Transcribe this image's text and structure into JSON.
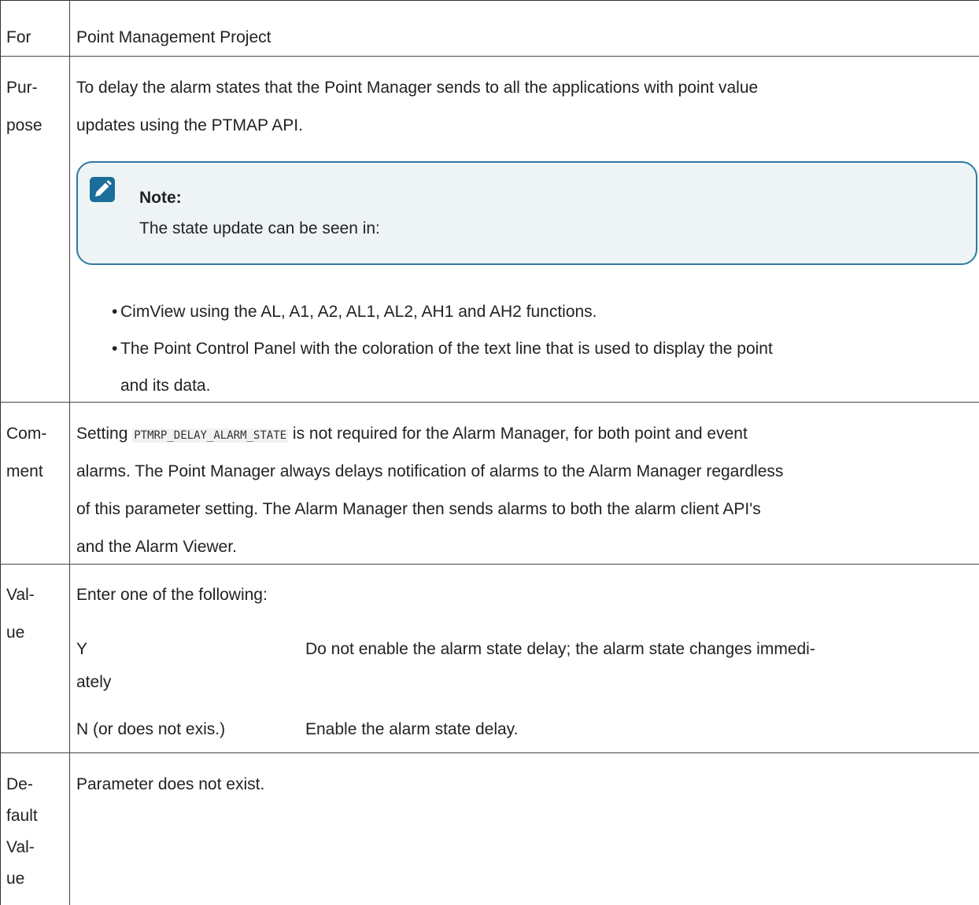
{
  "rows": {
    "for": {
      "label": "For",
      "text": "Point Management Project"
    },
    "purpose": {
      "label": [
        "Pur-",
        "pose"
      ],
      "text_lines": [
        "To delay the alarm states that the Point Manager sends to all the applications with point value",
        "updates using the PTMAP API."
      ],
      "note": {
        "icon": "pencil-note-icon",
        "title": "Note:",
        "body": "The state update can be seen in:"
      },
      "bullets": [
        "CimView using the AL, A1, A2, AL1, AL2, AH1 and  AH2 functions.",
        "The Point Control Panel with the coloration of the text line that is used to display the point"
      ],
      "bullet2_cont": "and its data."
    },
    "comment": {
      "label": [
        "Com-",
        "ment"
      ],
      "line1_pre": "Setting ",
      "code": "PTMRP_DELAY_ALARM_STATE",
      "line1_post": " is not required for the Alarm Manager, for both point and event",
      "lines": [
        "alarms. The Point Manager always delays notification of alarms to the Alarm Manager regardless",
        "of this parameter setting. The Alarm Manager then sends alarms to both the alarm client API's",
        "and the Alarm Viewer."
      ]
    },
    "value": {
      "label": [
        "Val-",
        "ue"
      ],
      "intro": "Enter one of the following:",
      "options": [
        {
          "key": "Y",
          "desc": "Do not enable the alarm state delay; the alarm state changes immedi-",
          "desc_cont": "ately"
        },
        {
          "key": "N (or does not exis.)",
          "desc": "Enable the alarm state delay."
        }
      ]
    },
    "default": {
      "label": [
        "De-",
        "fault",
        "Val-",
        "ue"
      ],
      "text": "Parameter does not exist."
    }
  },
  "colors": {
    "note_border": "#2d7aa0",
    "note_bg": "#eef4f6",
    "icon": "#1a6e99"
  }
}
